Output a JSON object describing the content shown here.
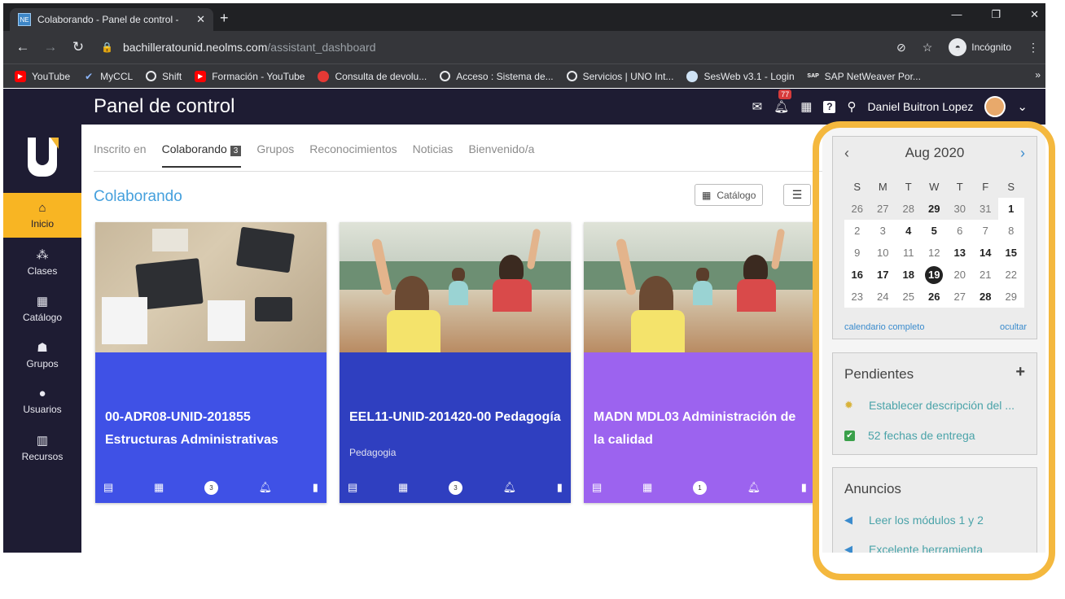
{
  "browser": {
    "tab_title": "Colaborando - Panel de control - ",
    "tab_favicon": "NE",
    "url_host": "bachilleratounid.neolms.com",
    "url_path": "/assistant_dashboard",
    "incognito_label": "Incógnito",
    "bookmarks": [
      {
        "label": "YouTube",
        "icon": "youtube-icon"
      },
      {
        "label": "MyCCL",
        "icon": "checkmark-icon"
      },
      {
        "label": "Shift",
        "icon": "globe-icon"
      },
      {
        "label": "Formación - YouTube",
        "icon": "youtube-icon"
      },
      {
        "label": "Consulta de devolu...",
        "icon": "red-dot-icon"
      },
      {
        "label": "Acceso : Sistema de...",
        "icon": "globe-icon"
      },
      {
        "label": "Servicios | UNO Int...",
        "icon": "globe-icon"
      },
      {
        "label": "SesWeb v3.1 - Login",
        "icon": "blue-globe-icon"
      },
      {
        "label": "SAP NetWeaver Por...",
        "icon": "sap-icon"
      }
    ]
  },
  "header": {
    "title": "Panel de control",
    "notification_count": "77",
    "user_name": "Daniel Buitron Lopez"
  },
  "sidebar": {
    "items": [
      {
        "label": "Inicio",
        "icon": "home-icon"
      },
      {
        "label": "Clases",
        "icon": "classes-icon"
      },
      {
        "label": "Catálogo",
        "icon": "catalog-icon"
      },
      {
        "label": "Grupos",
        "icon": "groups-icon"
      },
      {
        "label": "Usuarios",
        "icon": "user-icon"
      },
      {
        "label": "Recursos",
        "icon": "resources-icon"
      }
    ]
  },
  "main": {
    "tabs": [
      {
        "label": "Inscrito en"
      },
      {
        "label": "Colaborando",
        "count": "3"
      },
      {
        "label": "Grupos"
      },
      {
        "label": "Reconocimientos"
      },
      {
        "label": "Noticias"
      },
      {
        "label": "Bienvenido/a"
      }
    ],
    "section_title": "Colaborando",
    "catalog_button": "Catálogo",
    "cards": [
      {
        "name": "00-ADR08-UNID-201855 Estructuras Administrativas",
        "subtitle": "",
        "badge": "3",
        "color": "#3f51e6"
      },
      {
        "name": "EEL11-UNID-201420-00 Pedagogía",
        "subtitle": "Pedagogia",
        "badge": "3",
        "color": "#2f3fc0"
      },
      {
        "name": "MADN MDL03 Administración de la calidad",
        "subtitle": "",
        "badge": "1",
        "color": "#9c63ef"
      }
    ]
  },
  "calendar": {
    "month": "Aug 2020",
    "weekdays": [
      "S",
      "M",
      "T",
      "W",
      "T",
      "F",
      "S"
    ],
    "weeks": [
      [
        "26",
        "27",
        "28",
        "29",
        "30",
        "31",
        "1"
      ],
      [
        "2",
        "3",
        "4",
        "5",
        "6",
        "7",
        "8"
      ],
      [
        "9",
        "10",
        "11",
        "12",
        "13",
        "14",
        "15"
      ],
      [
        "16",
        "17",
        "18",
        "19",
        "20",
        "21",
        "22"
      ],
      [
        "23",
        "24",
        "25",
        "26",
        "27",
        "28",
        "29"
      ]
    ],
    "full_link": "calendario completo",
    "hide_link": "ocultar"
  },
  "pending": {
    "title": "Pendientes",
    "items": [
      {
        "label": "Establecer descripción del ...",
        "icon": "lightbulb-icon"
      },
      {
        "label": "52 fechas de entrega",
        "icon": "checkbox-icon"
      }
    ]
  },
  "announcements": {
    "title": "Anuncios",
    "items": [
      {
        "label": "Leer los módulos 1 y 2",
        "icon": "megaphone-icon"
      },
      {
        "label": "Excelente herramienta",
        "icon": "megaphone-icon"
      }
    ]
  },
  "colors": {
    "highlight": "#f4b83e",
    "sidebar_bg": "#1e1c33",
    "active_item": "#f8b523",
    "link": "#3a8bcd"
  }
}
